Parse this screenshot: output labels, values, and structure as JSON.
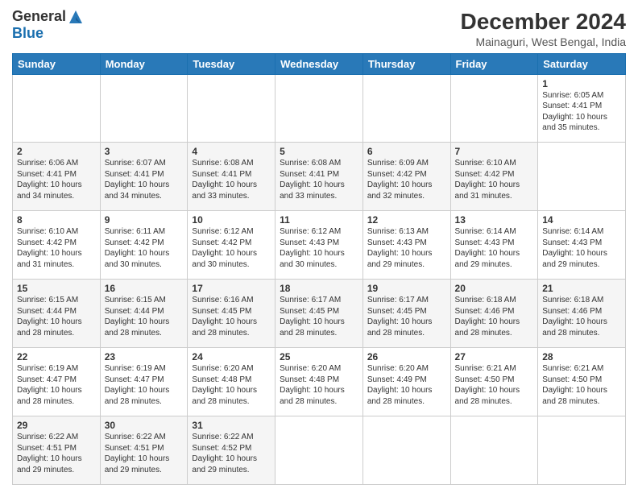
{
  "header": {
    "logo_general": "General",
    "logo_blue": "Blue",
    "title": "December 2024",
    "subtitle": "Mainaguri, West Bengal, India"
  },
  "calendar": {
    "days": [
      "Sunday",
      "Monday",
      "Tuesday",
      "Wednesday",
      "Thursday",
      "Friday",
      "Saturday"
    ],
    "weeks": [
      [
        null,
        null,
        null,
        null,
        null,
        null,
        {
          "day": "1",
          "sunrise": "6:05 AM",
          "sunset": "4:41 PM",
          "daylight": "10 hours and 35 minutes."
        }
      ],
      [
        {
          "day": "2",
          "sunrise": "6:06 AM",
          "sunset": "4:41 PM",
          "daylight": "10 hours and 34 minutes."
        },
        {
          "day": "3",
          "sunrise": "6:07 AM",
          "sunset": "4:41 PM",
          "daylight": "10 hours and 34 minutes."
        },
        {
          "day": "4",
          "sunrise": "6:08 AM",
          "sunset": "4:41 PM",
          "daylight": "10 hours and 33 minutes."
        },
        {
          "day": "5",
          "sunrise": "6:08 AM",
          "sunset": "4:41 PM",
          "daylight": "10 hours and 33 minutes."
        },
        {
          "day": "6",
          "sunrise": "6:09 AM",
          "sunset": "4:42 PM",
          "daylight": "10 hours and 32 minutes."
        },
        {
          "day": "7",
          "sunrise": "6:10 AM",
          "sunset": "4:42 PM",
          "daylight": "10 hours and 31 minutes."
        }
      ],
      [
        {
          "day": "8",
          "sunrise": "6:10 AM",
          "sunset": "4:42 PM",
          "daylight": "10 hours and 31 minutes."
        },
        {
          "day": "9",
          "sunrise": "6:11 AM",
          "sunset": "4:42 PM",
          "daylight": "10 hours and 30 minutes."
        },
        {
          "day": "10",
          "sunrise": "6:12 AM",
          "sunset": "4:42 PM",
          "daylight": "10 hours and 30 minutes."
        },
        {
          "day": "11",
          "sunrise": "6:12 AM",
          "sunset": "4:43 PM",
          "daylight": "10 hours and 30 minutes."
        },
        {
          "day": "12",
          "sunrise": "6:13 AM",
          "sunset": "4:43 PM",
          "daylight": "10 hours and 29 minutes."
        },
        {
          "day": "13",
          "sunrise": "6:14 AM",
          "sunset": "4:43 PM",
          "daylight": "10 hours and 29 minutes."
        },
        {
          "day": "14",
          "sunrise": "6:14 AM",
          "sunset": "4:43 PM",
          "daylight": "10 hours and 29 minutes."
        }
      ],
      [
        {
          "day": "15",
          "sunrise": "6:15 AM",
          "sunset": "4:44 PM",
          "daylight": "10 hours and 28 minutes."
        },
        {
          "day": "16",
          "sunrise": "6:15 AM",
          "sunset": "4:44 PM",
          "daylight": "10 hours and 28 minutes."
        },
        {
          "day": "17",
          "sunrise": "6:16 AM",
          "sunset": "4:45 PM",
          "daylight": "10 hours and 28 minutes."
        },
        {
          "day": "18",
          "sunrise": "6:17 AM",
          "sunset": "4:45 PM",
          "daylight": "10 hours and 28 minutes."
        },
        {
          "day": "19",
          "sunrise": "6:17 AM",
          "sunset": "4:45 PM",
          "daylight": "10 hours and 28 minutes."
        },
        {
          "day": "20",
          "sunrise": "6:18 AM",
          "sunset": "4:46 PM",
          "daylight": "10 hours and 28 minutes."
        },
        {
          "day": "21",
          "sunrise": "6:18 AM",
          "sunset": "4:46 PM",
          "daylight": "10 hours and 28 minutes."
        }
      ],
      [
        {
          "day": "22",
          "sunrise": "6:19 AM",
          "sunset": "4:47 PM",
          "daylight": "10 hours and 28 minutes."
        },
        {
          "day": "23",
          "sunrise": "6:19 AM",
          "sunset": "4:47 PM",
          "daylight": "10 hours and 28 minutes."
        },
        {
          "day": "24",
          "sunrise": "6:20 AM",
          "sunset": "4:48 PM",
          "daylight": "10 hours and 28 minutes."
        },
        {
          "day": "25",
          "sunrise": "6:20 AM",
          "sunset": "4:48 PM",
          "daylight": "10 hours and 28 minutes."
        },
        {
          "day": "26",
          "sunrise": "6:20 AM",
          "sunset": "4:49 PM",
          "daylight": "10 hours and 28 minutes."
        },
        {
          "day": "27",
          "sunrise": "6:21 AM",
          "sunset": "4:50 PM",
          "daylight": "10 hours and 28 minutes."
        },
        {
          "day": "28",
          "sunrise": "6:21 AM",
          "sunset": "4:50 PM",
          "daylight": "10 hours and 28 minutes."
        }
      ],
      [
        {
          "day": "29",
          "sunrise": "6:22 AM",
          "sunset": "4:51 PM",
          "daylight": "10 hours and 29 minutes."
        },
        {
          "day": "30",
          "sunrise": "6:22 AM",
          "sunset": "4:51 PM",
          "daylight": "10 hours and 29 minutes."
        },
        {
          "day": "31",
          "sunrise": "6:22 AM",
          "sunset": "4:52 PM",
          "daylight": "10 hours and 29 minutes."
        },
        null,
        null,
        null,
        null
      ]
    ]
  }
}
